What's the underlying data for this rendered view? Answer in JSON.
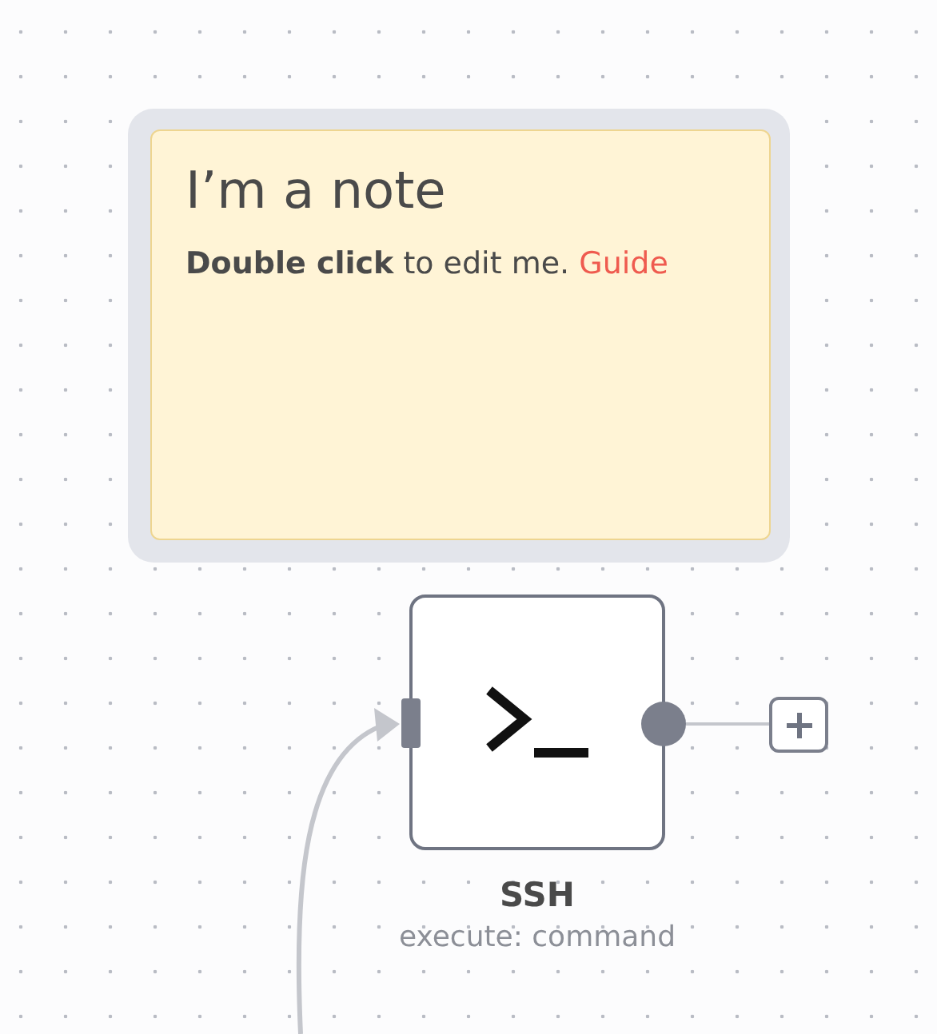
{
  "note": {
    "title": "I’m a note",
    "body": "**Double click** to edit me.",
    "link": "Guide"
  },
  "node": {
    "name": "SSH",
    "subtitle": "execute: command"
  }
}
